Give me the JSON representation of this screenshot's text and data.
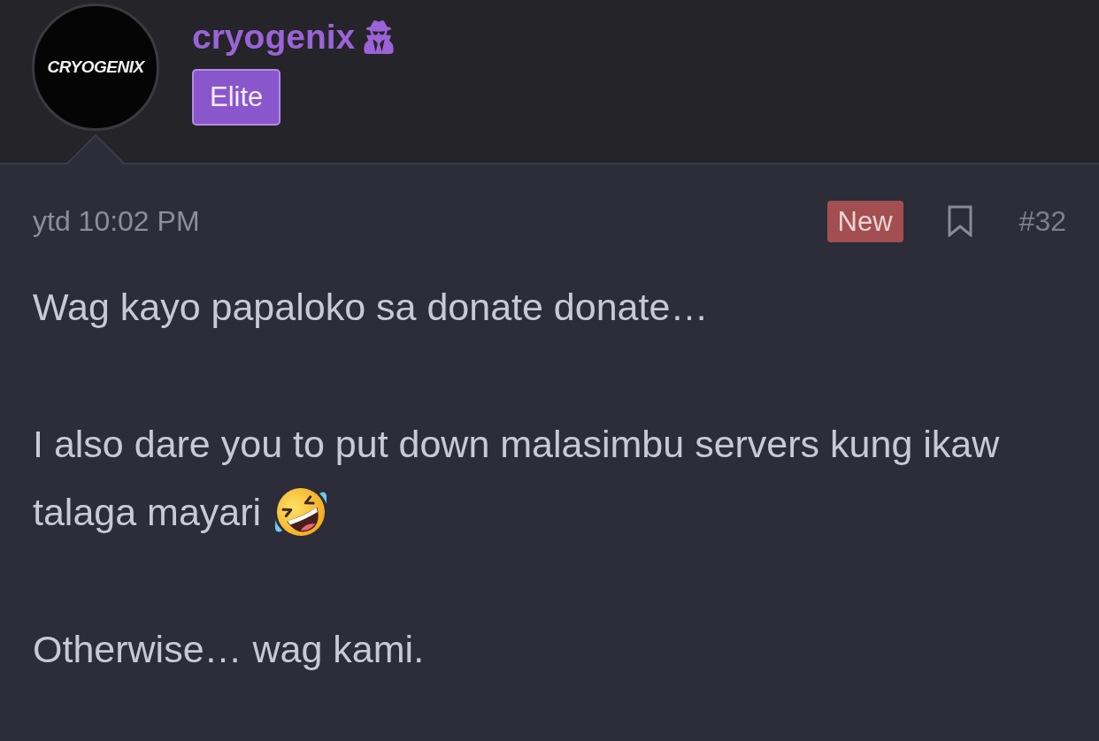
{
  "post": {
    "author": {
      "avatar_text": "CRYOGENIX",
      "username": "cryogenix",
      "user_title": "Elite"
    },
    "meta": {
      "time": "ytd 10:02 PM",
      "badge": "New",
      "bookmarked": false,
      "post_number": "#32"
    },
    "paragraphs": [
      {
        "lines": [
          "Wag kayo papaloko sa donate donate…"
        ]
      },
      {
        "lines": [
          "I also dare you to put down malasimbu servers kung ikaw",
          "talaga mayari"
        ]
      },
      {
        "lines": [
          "Otherwise… wag kami."
        ]
      }
    ]
  }
}
